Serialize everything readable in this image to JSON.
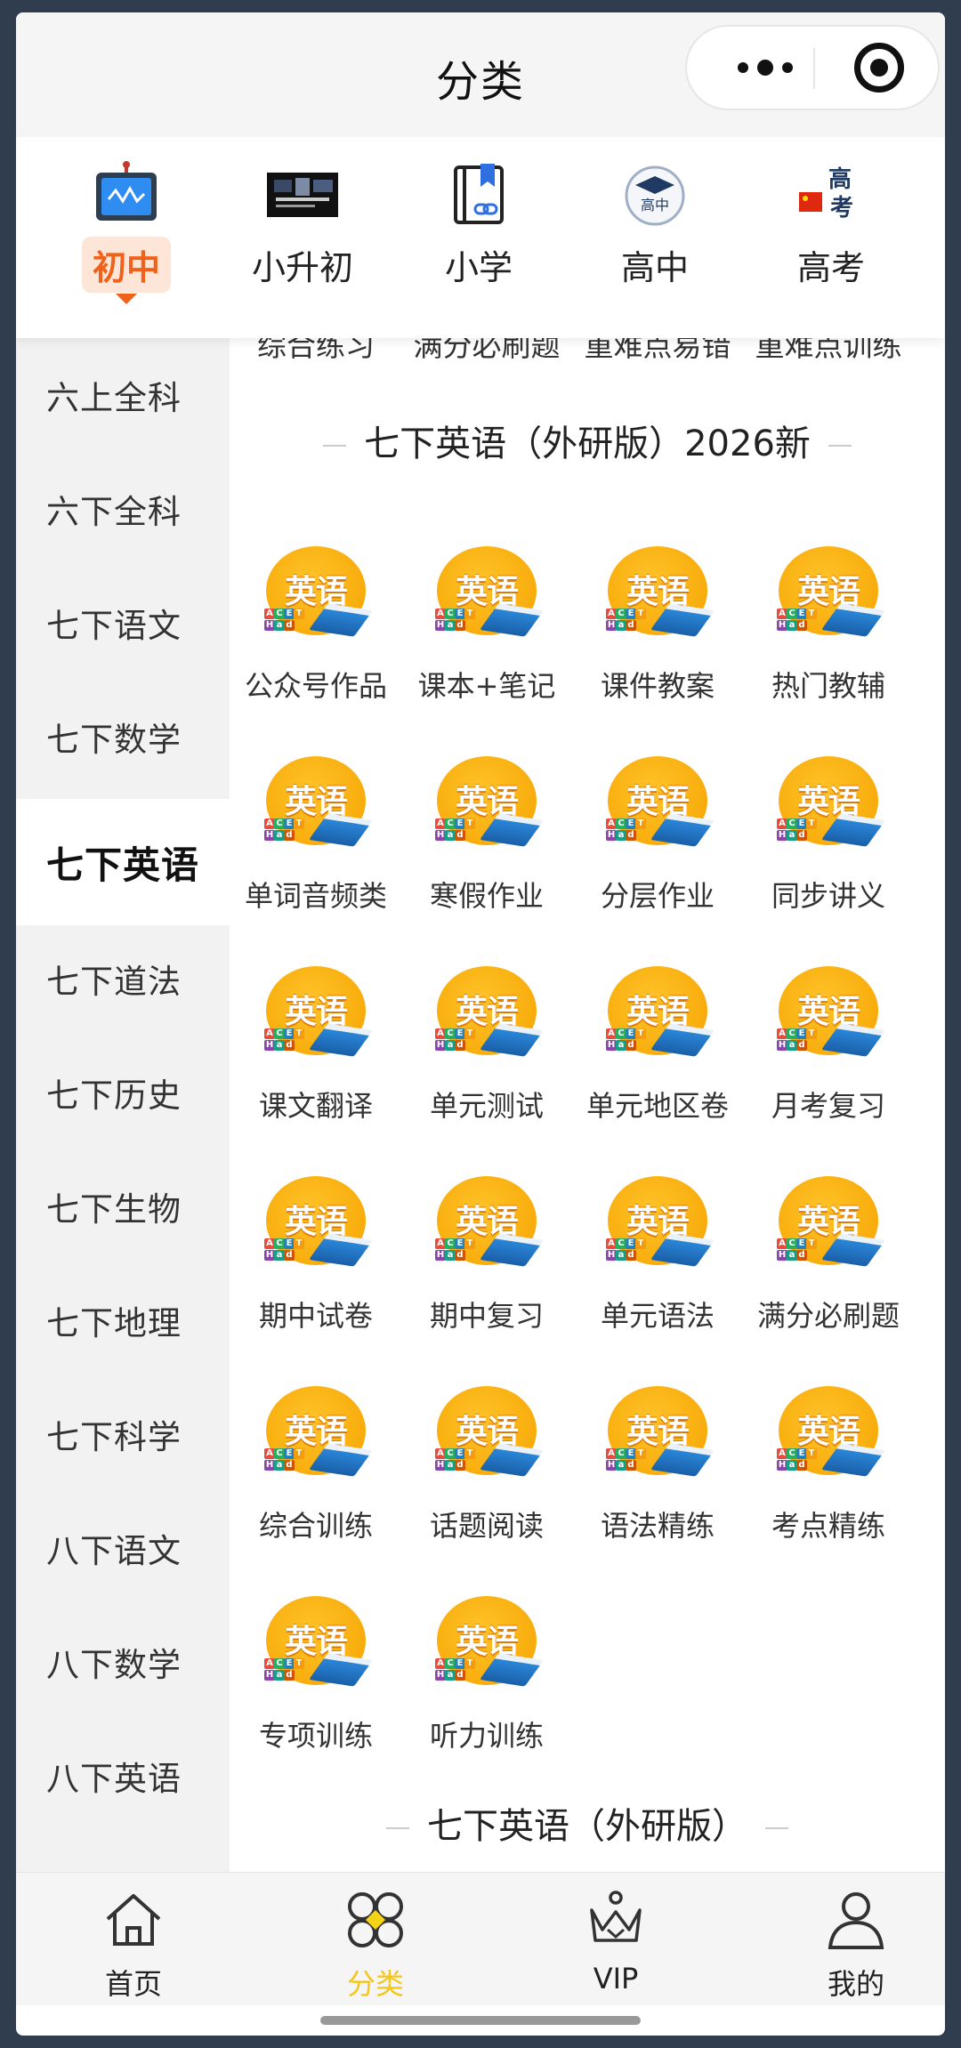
{
  "title_bar": {
    "title": "分类"
  },
  "stage_tabs": [
    {
      "label": "初中",
      "icon": "tv-icon",
      "active": true
    },
    {
      "label": "小升初",
      "icon": "photo-collage-icon",
      "active": false
    },
    {
      "label": "小学",
      "icon": "bookmark-book-icon",
      "active": false
    },
    {
      "label": "高中",
      "icon": "graduation-badge-icon",
      "active": false
    },
    {
      "label": "高考",
      "icon": "gaokao-flag-icon",
      "active": false
    }
  ],
  "subjects": [
    {
      "label": "六上全科",
      "active": false
    },
    {
      "label": "六下全科",
      "active": false
    },
    {
      "label": "七下语文",
      "active": false
    },
    {
      "label": "七下数学",
      "active": false
    },
    {
      "label": "七下英语",
      "active": true
    },
    {
      "label": "七下道法",
      "active": false
    },
    {
      "label": "七下历史",
      "active": false
    },
    {
      "label": "七下生物",
      "active": false
    },
    {
      "label": "七下地理",
      "active": false
    },
    {
      "label": "七下科学",
      "active": false
    },
    {
      "label": "八下语文",
      "active": false
    },
    {
      "label": "八下数学",
      "active": false
    },
    {
      "label": "八下英语",
      "active": false
    }
  ],
  "previous_row": [
    "综合练习",
    "满分必刷题",
    "重难点易错",
    "重难点训练"
  ],
  "section": {
    "title": "七下英语（外研版）2026新",
    "thumbnail_word": "英语",
    "items": [
      "公众号作品",
      "课本+笔记",
      "课件教案",
      "热门教辅",
      "单词音频类",
      "寒假作业",
      "分层作业",
      "同步讲义",
      "课文翻译",
      "单元测试",
      "单元地区卷",
      "月考复习",
      "期中试卷",
      "期中复习",
      "单元语法",
      "满分必刷题",
      "综合训练",
      "话题阅读",
      "语法精练",
      "考点精练",
      "专项训练",
      "听力训练"
    ]
  },
  "next_section": {
    "title": "七下英语（外研版）"
  },
  "bottom_nav": [
    {
      "label": "首页",
      "icon": "home-icon",
      "active": false
    },
    {
      "label": "分类",
      "icon": "category-icon",
      "active": true
    },
    {
      "label": "VIP",
      "icon": "crown-icon",
      "active": false
    },
    {
      "label": "我的",
      "icon": "profile-icon",
      "active": false
    }
  ],
  "colors": {
    "accent_orange": "#f0621b",
    "accent_yellow": "#f5c518",
    "sidebar_bg": "#f2f2f2"
  }
}
